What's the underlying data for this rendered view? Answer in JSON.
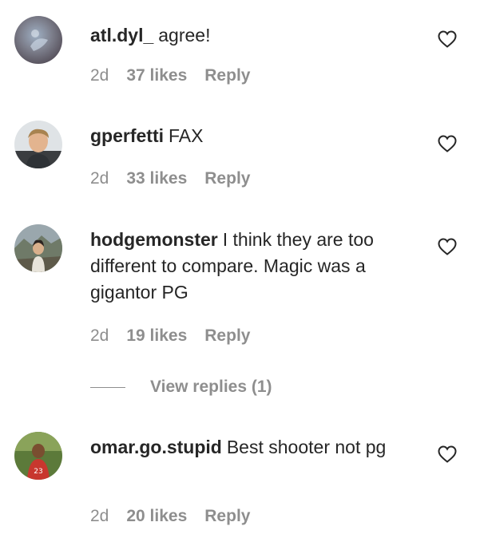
{
  "comments": [
    {
      "username": "atl.dyl_",
      "text": "agree!",
      "time": "2d",
      "likes": "37 likes",
      "reply": "Reply",
      "like_icon": "heart-outline-icon"
    },
    {
      "username": "gperfetti",
      "text": "FAX",
      "time": "2d",
      "likes": "33 likes",
      "reply": "Reply",
      "like_icon": "heart-outline-icon"
    },
    {
      "username": "hodgemonster",
      "text": "I think they are too different to compare. Magic was a gigantor PG",
      "time": "2d",
      "likes": "19 likes",
      "reply": "Reply",
      "like_icon": "heart-outline-icon",
      "view_replies": "View replies (1)"
    },
    {
      "username": "omar.go.stupid",
      "text": "Best shooter not pg",
      "time": "2d",
      "likes": "20 likes",
      "reply": "Reply",
      "like_icon": "heart-outline-icon"
    }
  ],
  "colors": {
    "text": "#262626",
    "secondary": "#8e8e8e",
    "background": "#ffffff"
  }
}
